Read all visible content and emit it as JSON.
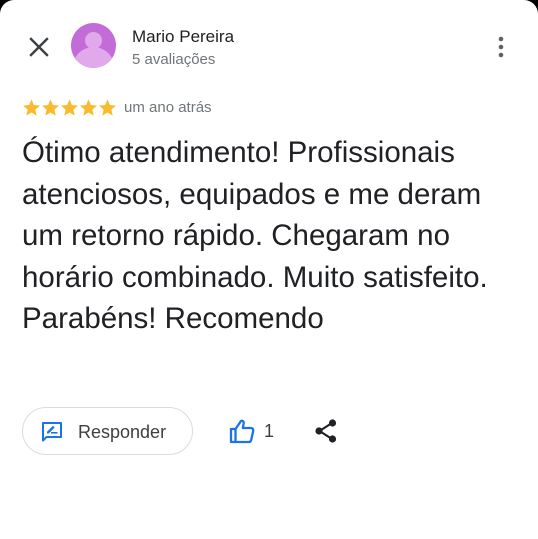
{
  "author": {
    "name": "Mario Pereira",
    "reviews_count": "5 avaliações",
    "avatar_color": "#c36bd6"
  },
  "review": {
    "rating": 5,
    "max_rating": 5,
    "star_color": "#f9bb2d",
    "time_ago": "um ano atrás",
    "text": "Ótimo atendimento! Profissionais atenciosos, equipados e me deram um retorno rápido. Chegaram no horário combinado. Muito satisfeito. Parabéns! Recomendo"
  },
  "actions": {
    "reply_label": "Responder",
    "like_count": "1",
    "accent_color": "#1a73e8"
  },
  "icons": {
    "close": "close-icon",
    "more": "more-vert-icon",
    "reply": "rate-review-icon",
    "like": "thumb-up-icon",
    "share": "share-icon"
  }
}
